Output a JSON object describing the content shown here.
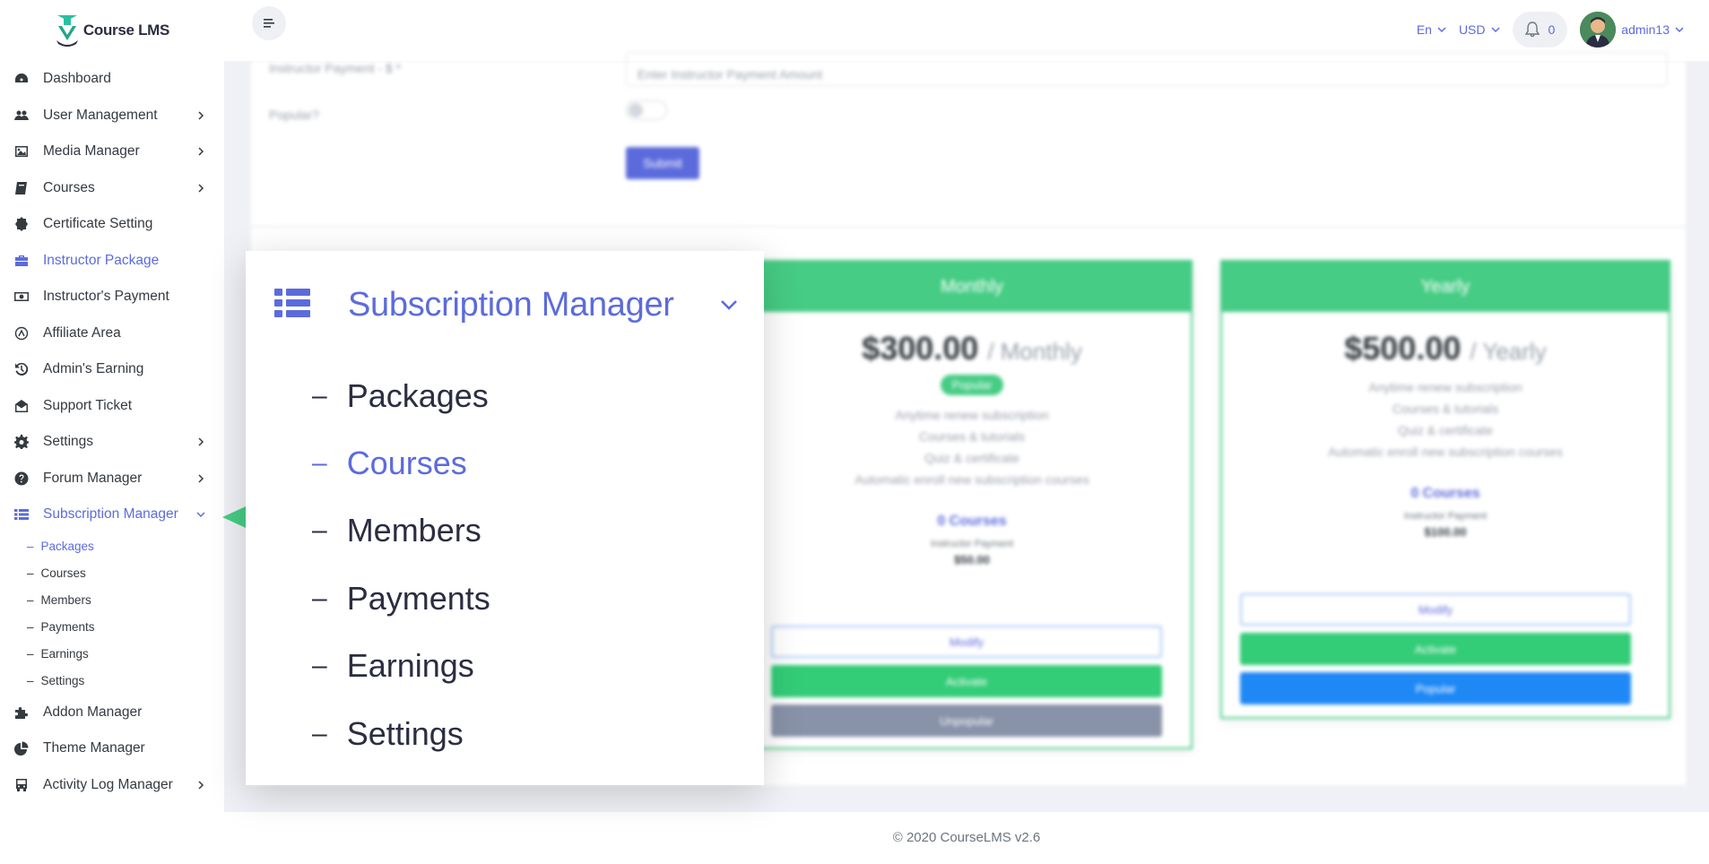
{
  "app": {
    "logo_text": "Course LMS"
  },
  "header": {
    "language": "En",
    "currency": "USD",
    "notification_count": "0",
    "username": "admin13"
  },
  "sidebar": {
    "items": [
      {
        "label": "Dashboard",
        "icon": "dashboard-icon",
        "has_children": false
      },
      {
        "label": "User Management",
        "icon": "users-icon",
        "has_children": true
      },
      {
        "label": "Media Manager",
        "icon": "image-icon",
        "has_children": true
      },
      {
        "label": "Courses",
        "icon": "book-icon",
        "has_children": true
      },
      {
        "label": "Certificate Setting",
        "icon": "certificate-icon",
        "has_children": false
      },
      {
        "label": "Instructor Package",
        "icon": "briefcase-icon",
        "has_children": false,
        "active": true
      },
      {
        "label": "Instructor's Payment",
        "icon": "money-icon",
        "has_children": false
      },
      {
        "label": "Affiliate Area",
        "icon": "affiliate-icon",
        "has_children": false
      },
      {
        "label": "Admin's Earning",
        "icon": "history-icon",
        "has_children": false
      },
      {
        "label": "Support Ticket",
        "icon": "envelope-open-icon",
        "has_children": false
      },
      {
        "label": "Settings",
        "icon": "gear-icon",
        "has_children": true
      },
      {
        "label": "Forum Manager",
        "icon": "question-icon",
        "has_children": true
      },
      {
        "label": "Subscription Manager",
        "icon": "list-icon",
        "has_children": true,
        "expanded": true
      },
      {
        "label": "Addon Manager",
        "icon": "puzzle-icon",
        "has_children": false
      },
      {
        "label": "Theme Manager",
        "icon": "pie-icon",
        "has_children": false
      },
      {
        "label": "Activity Log Manager",
        "icon": "bus-icon",
        "has_children": true
      }
    ],
    "submenu": [
      {
        "label": "Packages",
        "active": true
      },
      {
        "label": "Courses"
      },
      {
        "label": "Members"
      },
      {
        "label": "Payments"
      },
      {
        "label": "Earnings"
      },
      {
        "label": "Settings"
      }
    ]
  },
  "form": {
    "instructor_payment_label": "Instructor Payment - $ *",
    "instructor_payment_placeholder": "Enter Instructor Payment Amount",
    "popular_label": "Popular?",
    "submit_label": "Submit"
  },
  "packages": [
    {
      "name": "Monthly",
      "price": "$300.00",
      "period": "/ Monthly",
      "badge": "Popular",
      "features": [
        "Anytime renew subscription",
        "Courses & tutorials",
        "Quiz & certificate",
        "Automatic enroll new subscription courses"
      ],
      "courses": "0 Courses",
      "ip_label": "Instructor Payment",
      "ip_value": "$50.00",
      "btn_modify": "Modify",
      "btn_activate": "Activate",
      "btn_third": "Unpopular"
    },
    {
      "name": "Yearly",
      "price": "$500.00",
      "period": "/ Yearly",
      "features": [
        "Anytime renew subscription",
        "Courses & tutorials",
        "Quiz & certificate",
        "Automatic enroll new subscription courses"
      ],
      "courses": "0 Courses",
      "ip_label": "Instructor Payment",
      "ip_value": "$100.00",
      "btn_modify": "Modify",
      "btn_activate": "Activate",
      "btn_third": "Popular"
    }
  ],
  "zoom": {
    "title": "Subscription Manager",
    "items": [
      {
        "label": "Packages"
      },
      {
        "label": "Courses",
        "active": true
      },
      {
        "label": "Members"
      },
      {
        "label": "Payments"
      },
      {
        "label": "Earnings"
      },
      {
        "label": "Settings"
      }
    ]
  },
  "footer": {
    "text": "© 2020 CourseLMS v2.6"
  },
  "colors": {
    "accent": "#5c6bdc",
    "success": "#46cc84",
    "primary": "#1e88f5"
  }
}
